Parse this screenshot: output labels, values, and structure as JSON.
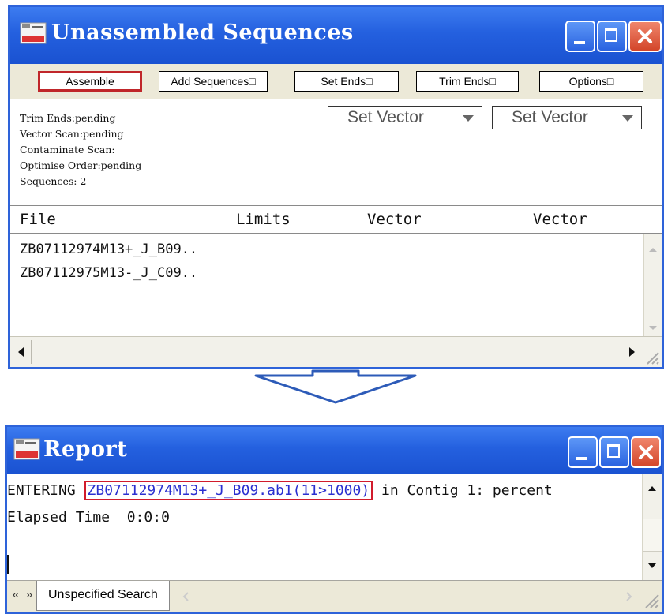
{
  "unassembled": {
    "title": "Unassembled Sequences",
    "toolbar": {
      "assemble": "Assemble",
      "add_sequences": "Add Sequences□",
      "set_ends": "Set Ends□",
      "trim_ends": "Trim Ends□",
      "options": "Options□"
    },
    "status": {
      "trim_ends": "Trim Ends:pending",
      "vector_scan": "Vector Scan:pending",
      "contaminate_scan": "Contaminate Scan:",
      "optimise_order": "Optimise Order:pending",
      "sequences": "Sequences: 2"
    },
    "vector_select_1": "Set Vector",
    "vector_select_2": "Set Vector",
    "columns": [
      "File",
      "Limits",
      "Vector",
      "Vector"
    ],
    "rows": [
      "ZB07112974M13+_J_B09..",
      "ZB07112975M13-_J_C09.."
    ]
  },
  "report": {
    "title": "Report",
    "line1_prefix": "ENTERING ",
    "line1_file": "ZB07112974M13+_J_B09.ab1(11>1000)",
    "line1_suffix": " in Contig 1: percent",
    "line2": "Elapsed Time  0:0:0",
    "nav_prev": "«",
    "nav_next": "»",
    "search_tab": "Unspecified Search"
  },
  "colors": {
    "titlebar": "#2460df",
    "highlight_border": "#d11b2c",
    "highlight_text": "#2a2fd0"
  }
}
